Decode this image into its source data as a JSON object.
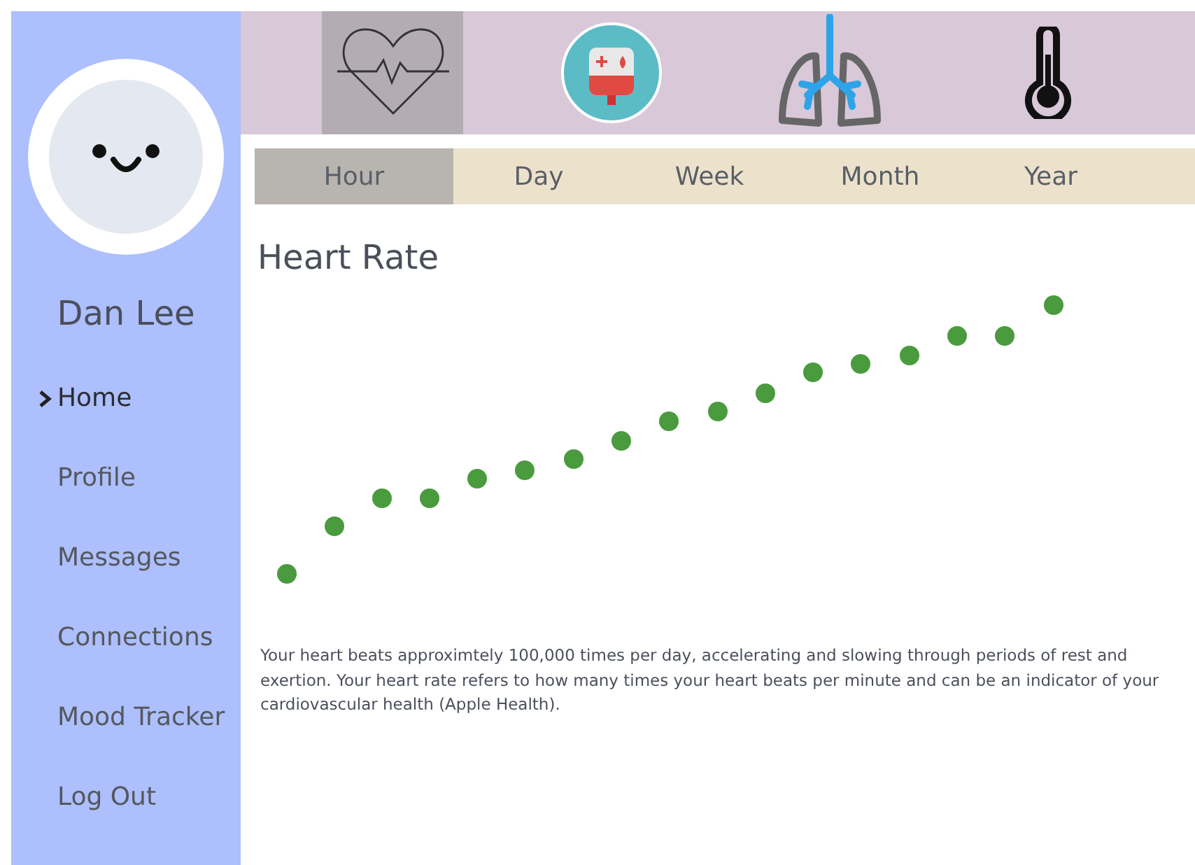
{
  "sidebar": {
    "user_name": "Dan Lee",
    "items": [
      {
        "label": "Home",
        "selected": true
      },
      {
        "label": "Profile",
        "selected": false
      },
      {
        "label": "Messages",
        "selected": false
      },
      {
        "label": "Connections",
        "selected": false
      },
      {
        "label": "Mood Tracker",
        "selected": false
      },
      {
        "label": "Log Out",
        "selected": false
      }
    ]
  },
  "icon_tabs": [
    {
      "kind": "heart",
      "selected": true
    },
    {
      "kind": "bloodbag",
      "selected": false
    },
    {
      "kind": "lungs",
      "selected": false
    },
    {
      "kind": "thermometer",
      "selected": false
    }
  ],
  "period_tabs": [
    {
      "label": "Hour",
      "selected": true
    },
    {
      "label": "Day",
      "selected": false
    },
    {
      "label": "Week",
      "selected": false
    },
    {
      "label": "Month",
      "selected": false
    },
    {
      "label": "Year",
      "selected": false
    }
  ],
  "title": "Heart Rate",
  "description": "Your heart beats approximtely 100,000 times per day, accelerating and slowing through periods of rest and exertion. Your heart rate refers to how many times your heart beats per minute and can be an indicator of your cardiovascular health (Apple Health)."
}
